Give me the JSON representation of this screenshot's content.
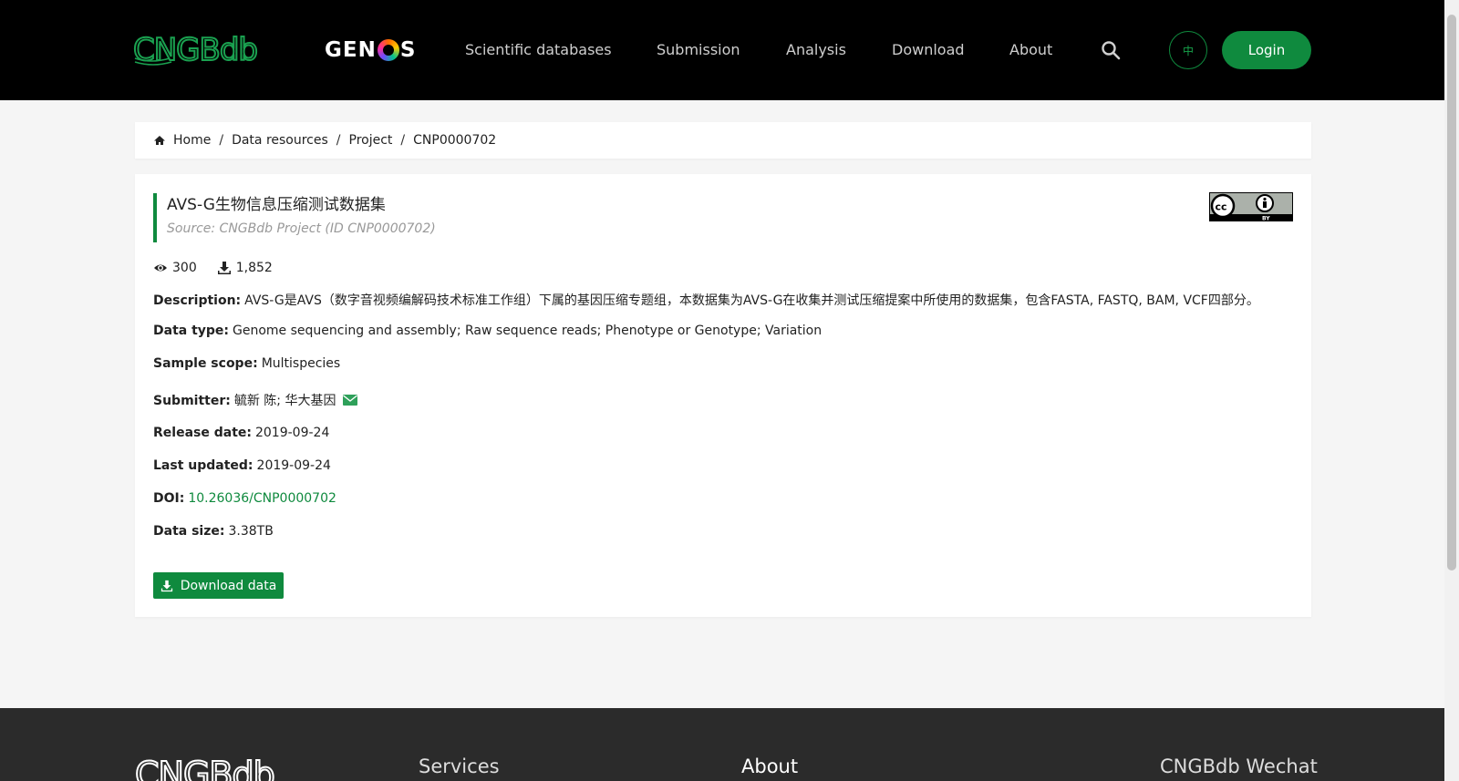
{
  "header": {
    "logo_text": "CNGBdb",
    "genos_logo_text_left": "GEN",
    "genos_logo_text_right": "S",
    "nav": [
      "Scientific databases",
      "Submission",
      "Analysis",
      "Download",
      "About"
    ],
    "lang_label": "中",
    "login_label": "Login"
  },
  "breadcrumb": {
    "items": [
      "Home",
      "Data resources",
      "Project",
      "CNP0000702"
    ],
    "separator": "/"
  },
  "project": {
    "title": "AVS-G生物信息压缩测试数据集",
    "source": "Source: CNGBdb Project (ID CNP0000702)",
    "views": "300",
    "downloads": "1,852",
    "description_label": "Description:",
    "description": "AVS-G是AVS（数字音视频编解码技术标准工作组）下属的基因压缩专题组，本数据集为AVS-G在收集并测试压缩提案中所使用的数据集，包含FASTA, FASTQ, BAM, VCF四部分。",
    "data_type_label": "Data type:",
    "data_type": "Genome sequencing and assembly; Raw sequence reads; Phenotype or Genotype; Variation",
    "sample_scope_label": "Sample scope:",
    "sample_scope": "Multispecies",
    "submitter_label": "Submitter:",
    "submitter": "毓新 陈; 华大基因",
    "release_date_label": "Release date:",
    "release_date": "2019-09-24",
    "last_updated_label": "Last updated:",
    "last_updated": "2019-09-24",
    "doi_label": "DOI:",
    "doi": "10.26036/CNP0000702",
    "data_size_label": "Data size:",
    "data_size": "3.38TB",
    "download_label": "Download data",
    "license_badge_text": "BY"
  },
  "footer": {
    "logo_text": "CNGBdb",
    "headings": [
      "Services",
      "About",
      "CNGBdb Wechat"
    ]
  },
  "colors": {
    "brand_green": "#0f8a3e",
    "header_bg": "#000000",
    "footer_bg": "#2b2b2b",
    "page_bg": "#f5f5f5"
  },
  "icons": [
    "home-icon",
    "search-icon",
    "eye-icon",
    "download-icon",
    "mail-icon",
    "cc-by-license-icon"
  ]
}
